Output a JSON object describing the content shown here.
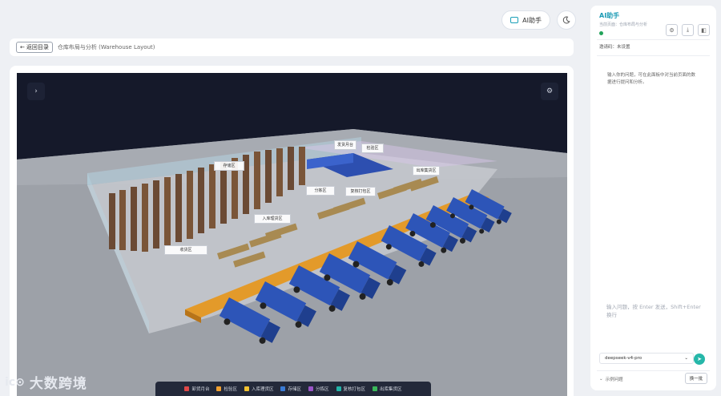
{
  "header": {
    "ai_button_label": "AI助手",
    "ai_icon": "ai-panel-icon",
    "theme_icon": "moon-icon"
  },
  "breadcrumb": {
    "back_label": "返回目录",
    "page_title": "仓库布局与分析 (Warehouse Layout)"
  },
  "scene": {
    "expand_icon": "chevron-right-icon",
    "settings_icon": "gear-icon",
    "zone_labels": [
      {
        "title": "收货区"
      },
      {
        "title": "入库理货区"
      },
      {
        "title": "存储区"
      },
      {
        "title": "分拣区"
      },
      {
        "title": "复核打包区"
      },
      {
        "title": "出库集货区"
      },
      {
        "title": "发货月台"
      },
      {
        "title": "检验区"
      }
    ],
    "legend": [
      {
        "label": "卸货月台",
        "color": "#e04848"
      },
      {
        "label": "检验区",
        "color": "#f0a030"
      },
      {
        "label": "入库理货区",
        "color": "#f2c230"
      },
      {
        "label": "存储区",
        "color": "#3a7bd5"
      },
      {
        "label": "分拣区",
        "color": "#9a55c8"
      },
      {
        "label": "复核打包区",
        "color": "#22b3a8"
      },
      {
        "label": "出库集货区",
        "color": "#3ab85a"
      }
    ]
  },
  "watermark": {
    "logo": "ic⊙",
    "text": "大数跨境"
  },
  "assistant": {
    "title": "AI助手",
    "subtitle": "当前页面：仓库布局与分析",
    "mode_label": "邀请码：未设置",
    "hint": "输入你的问题，可在此面板中对当前页面的数据进行提问和分析。",
    "input_placeholder": "输入问题，按 Enter 发送，Shift+Enter 换行",
    "model": "deepseek-v4-pro",
    "examples_label": "示例问题",
    "refresh_label": "换一批",
    "tools": [
      "settings-icon",
      "download-icon",
      "panel-toggle-icon"
    ]
  }
}
